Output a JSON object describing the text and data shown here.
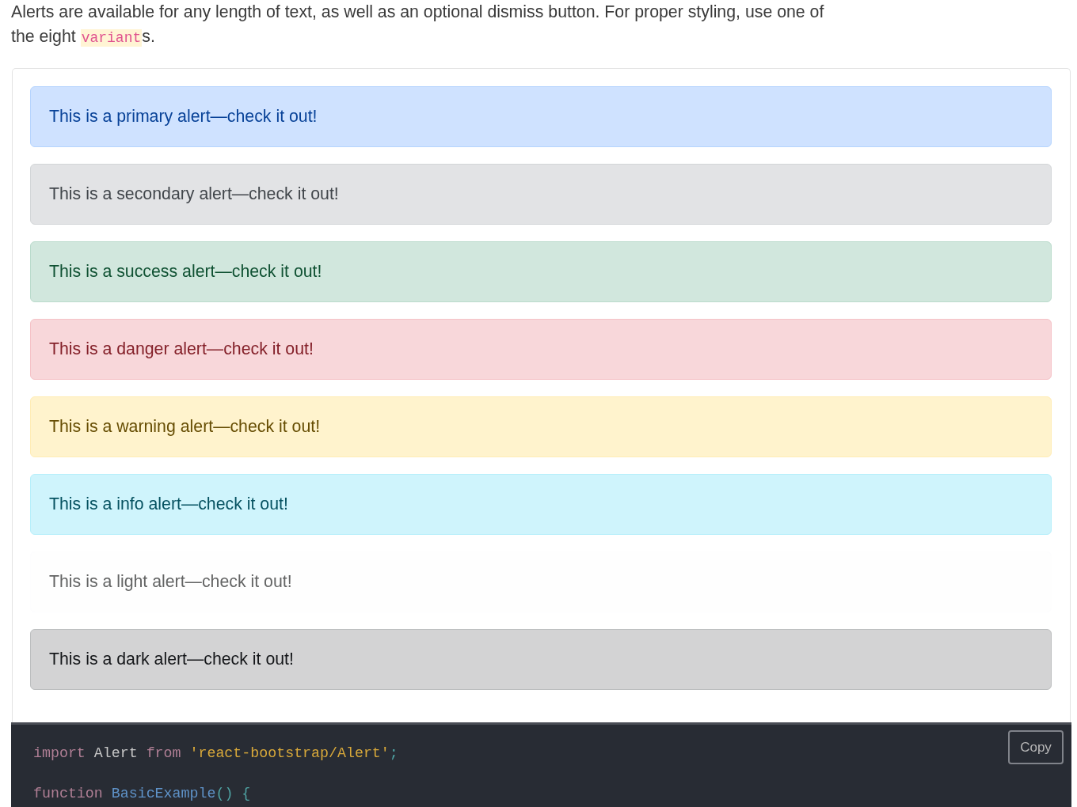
{
  "intro": {
    "text_before": "Alerts are available for any length of text, as well as an optional dismiss button. For proper styling, use one of the eight ",
    "code": "variant",
    "text_after": "s."
  },
  "alerts": [
    {
      "kind": "primary",
      "text": "This is a primary alert—check it out!"
    },
    {
      "kind": "secondary",
      "text": "This is a secondary alert—check it out!"
    },
    {
      "kind": "success",
      "text": "This is a success alert—check it out!"
    },
    {
      "kind": "danger",
      "text": "This is a danger alert—check it out!"
    },
    {
      "kind": "warning",
      "text": "This is a warning alert—check it out!"
    },
    {
      "kind": "info",
      "text": "This is a info alert—check it out!"
    },
    {
      "kind": "light",
      "text": "This is a light alert—check it out!"
    },
    {
      "kind": "dark",
      "text": "This is a dark alert—check it out!"
    }
  ],
  "code_block": {
    "copy_button": "Copy",
    "lines": [
      {
        "tokens": [
          {
            "kind": "keyword",
            "text": "import "
          },
          {
            "kind": "plain",
            "text": "Alert "
          },
          {
            "kind": "keyword",
            "text": "from "
          },
          {
            "kind": "string",
            "text": "'react-bootstrap/Alert'"
          },
          {
            "kind": "punctuation",
            "text": ";"
          }
        ]
      },
      {
        "tokens": [
          {
            "kind": "keyword",
            "text": "function "
          },
          {
            "kind": "function",
            "text": "BasicExample"
          },
          {
            "kind": "punctuation",
            "text": "() {"
          }
        ]
      }
    ]
  }
}
